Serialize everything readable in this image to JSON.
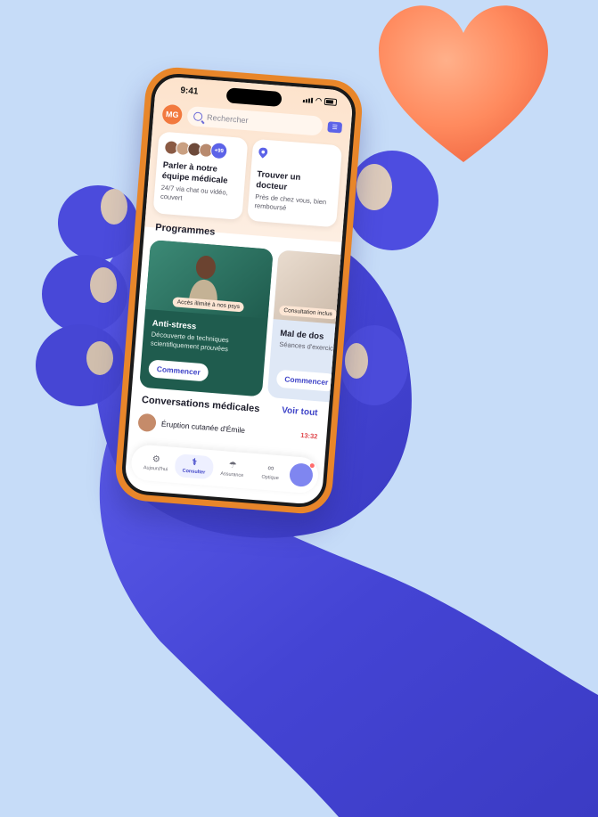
{
  "status_bar": {
    "time": "9:41"
  },
  "header": {
    "avatar_initials": "MG",
    "search_placeholder": "Rechercher"
  },
  "cards": [
    {
      "title": "Parler à notre équipe médicale",
      "subtitle": "24/7 via chat ou vidéo, couvert",
      "badge": "+99",
      "icon": "team-faces-icon"
    },
    {
      "title": "Trouver un docteur",
      "subtitle": "Près de chez vous, bien remboursé",
      "icon": "location-pin-icon"
    }
  ],
  "programmes": {
    "title": "Programmes",
    "items": [
      {
        "tag": "Accès illimité à nos psys",
        "title": "Anti-stress",
        "description": "Découverte de techniques scientifiquement prouvées",
        "button": "Commencer"
      },
      {
        "tag": "Consultation inclus",
        "title": "Mal de dos",
        "description": "Séances d'exercic... jours, suivi avec u...",
        "button": "Commencer"
      }
    ]
  },
  "conversations": {
    "title": "Conversations médicales",
    "link": "Voir tout",
    "items": [
      {
        "name": "Éruption cutanée d'Émile",
        "time": "13:32"
      }
    ]
  },
  "tabbar": [
    {
      "label": "Aujourd'hui",
      "icon": "gear-icon"
    },
    {
      "label": "Consulter",
      "icon": "stethoscope-icon",
      "active": true
    },
    {
      "label": "Assurance",
      "icon": "umbrella-icon"
    },
    {
      "label": "Optique",
      "icon": "glasses-icon"
    }
  ],
  "colors": {
    "accent": "#4045c8",
    "phone_case": "#e8862a",
    "background": "#c6dcf8",
    "heart": "#ff8e66",
    "fur": "#4f4fe0"
  }
}
